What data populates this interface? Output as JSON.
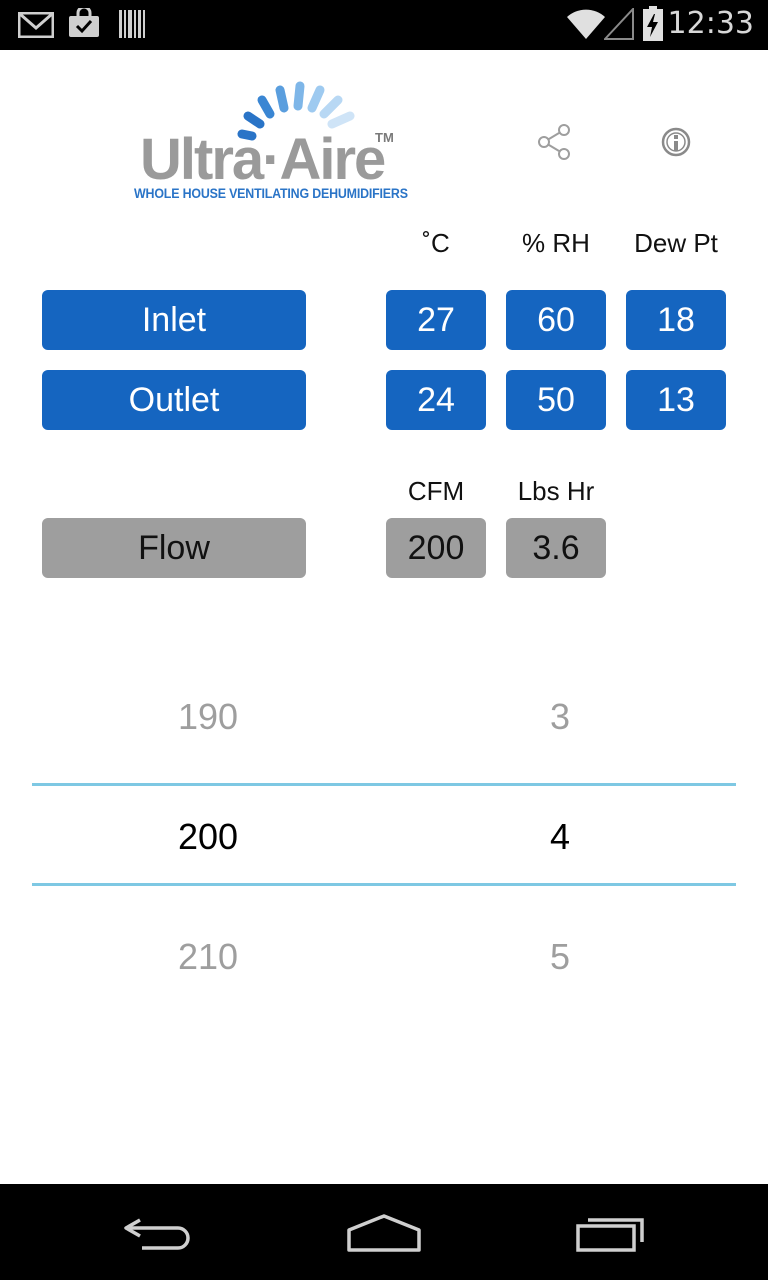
{
  "status_bar": {
    "time": "12:33",
    "icons": [
      "gmail-icon",
      "play-store-icon",
      "barcode-icon",
      "wifi-icon",
      "signal-icon",
      "battery-charging-icon"
    ]
  },
  "logo": {
    "name": "Ultra·Aire",
    "trademark": "TM",
    "tagline": "WHOLE HOUSE VENTILATING DEHUMIDIFIERS"
  },
  "toolbar": {
    "share_icon": "share-icon",
    "info_icon": "info-icon"
  },
  "headers": {
    "temp": "˚C",
    "rh": "% RH",
    "dew": "Dew Pt",
    "cfm": "CFM",
    "lbs": "Lbs Hr"
  },
  "rows": {
    "inlet": {
      "label": "Inlet",
      "temp": "27",
      "rh": "60",
      "dew": "18"
    },
    "outlet": {
      "label": "Outlet",
      "temp": "24",
      "rh": "50",
      "dew": "13"
    },
    "flow": {
      "label": "Flow",
      "cfm": "200",
      "lbs": "3.6"
    }
  },
  "picker": {
    "left": {
      "prev": "190",
      "selected": "200",
      "next": "210"
    },
    "right": {
      "prev": "3",
      "selected": "4",
      "next": "5"
    }
  },
  "colors": {
    "primary_blue": "#1565c0",
    "flow_gray": "#9e9e9e",
    "picker_line": "#7ec8e3",
    "logo_gray": "#9a9a9a",
    "logo_blue": "#2a74c7"
  },
  "nav": {
    "back_icon": "back-icon",
    "home_icon": "home-icon",
    "recents_icon": "recents-icon"
  }
}
